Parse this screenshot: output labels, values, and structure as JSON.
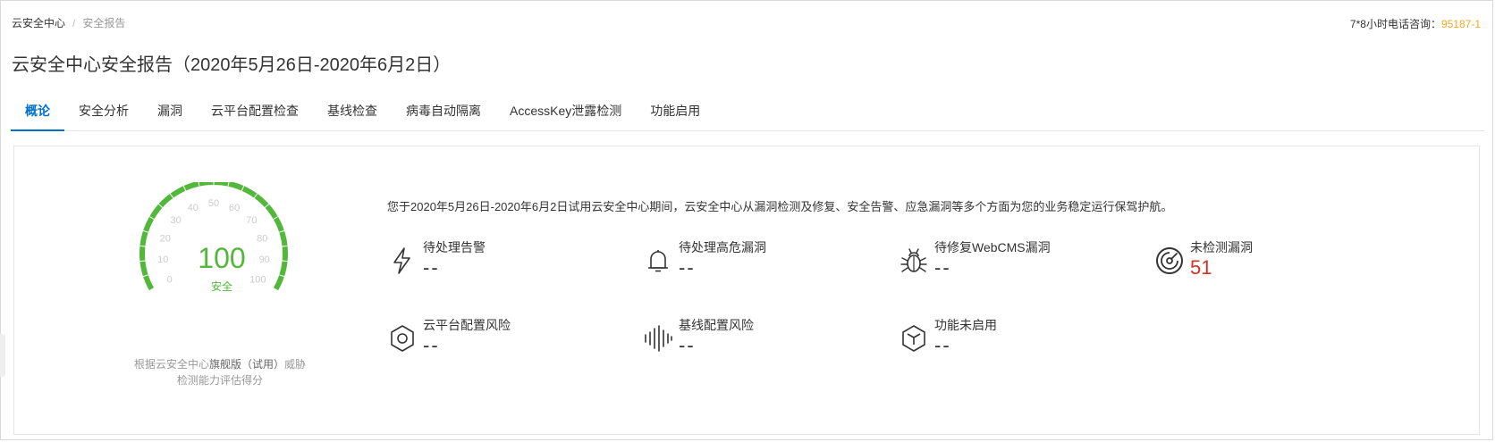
{
  "breadcrumb": {
    "home": "云安全中心",
    "separator": "/",
    "current": "安全报告"
  },
  "phone": {
    "label": "7*8小时电话咨询：",
    "number": "95187-1"
  },
  "title": "云安全中心安全报告（2020年5月26日-2020年6月2日）",
  "tabs": [
    {
      "label": "概论",
      "active": true
    },
    {
      "label": "安全分析"
    },
    {
      "label": "漏洞"
    },
    {
      "label": "云平台配置检查"
    },
    {
      "label": "基线检查"
    },
    {
      "label": "病毒自动隔离"
    },
    {
      "label": "AccessKey泄露检测"
    },
    {
      "label": "功能启用"
    }
  ],
  "gauge": {
    "score": "100",
    "status": "安全",
    "score_value": 100,
    "ticks": [
      "0",
      "10",
      "20",
      "30",
      "40",
      "50",
      "60",
      "70",
      "80",
      "90",
      "100"
    ],
    "caption_line1_pre": "根据云安全中心",
    "caption_line1_em": "旗舰版（试用）",
    "caption_line1_post": "威胁",
    "caption_line2": "检测能力评估得分",
    "color": "#52b83a"
  },
  "summary": "您于2020年5月26日-2020年6月2日试用云安全中心期间，云安全中心从漏洞检测及修复、安全告警、应急漏洞等多个方面为您的业务稳定运行保驾护航。",
  "metrics": [
    {
      "icon": "lightning-icon",
      "label": "待处理告警",
      "value": "--"
    },
    {
      "icon": "bell-icon",
      "label": "待处理高危漏洞",
      "value": "--"
    },
    {
      "icon": "bug-icon",
      "label": "待修复WebCMS漏洞",
      "value": "--"
    },
    {
      "icon": "radar-icon",
      "label": "未检测漏洞",
      "value": "51",
      "alert": true
    },
    {
      "icon": "hexagon-nut-icon",
      "label": "云平台配置风险",
      "value": "--"
    },
    {
      "icon": "soundwave-icon",
      "label": "基线配置风险",
      "value": "--"
    },
    {
      "icon": "cube-icon",
      "label": "功能未启用",
      "value": "--"
    }
  ],
  "colors": {
    "accent": "#0070cc",
    "phone": "#f5a623",
    "gauge": "#52b83a",
    "alert": "#d93026"
  }
}
